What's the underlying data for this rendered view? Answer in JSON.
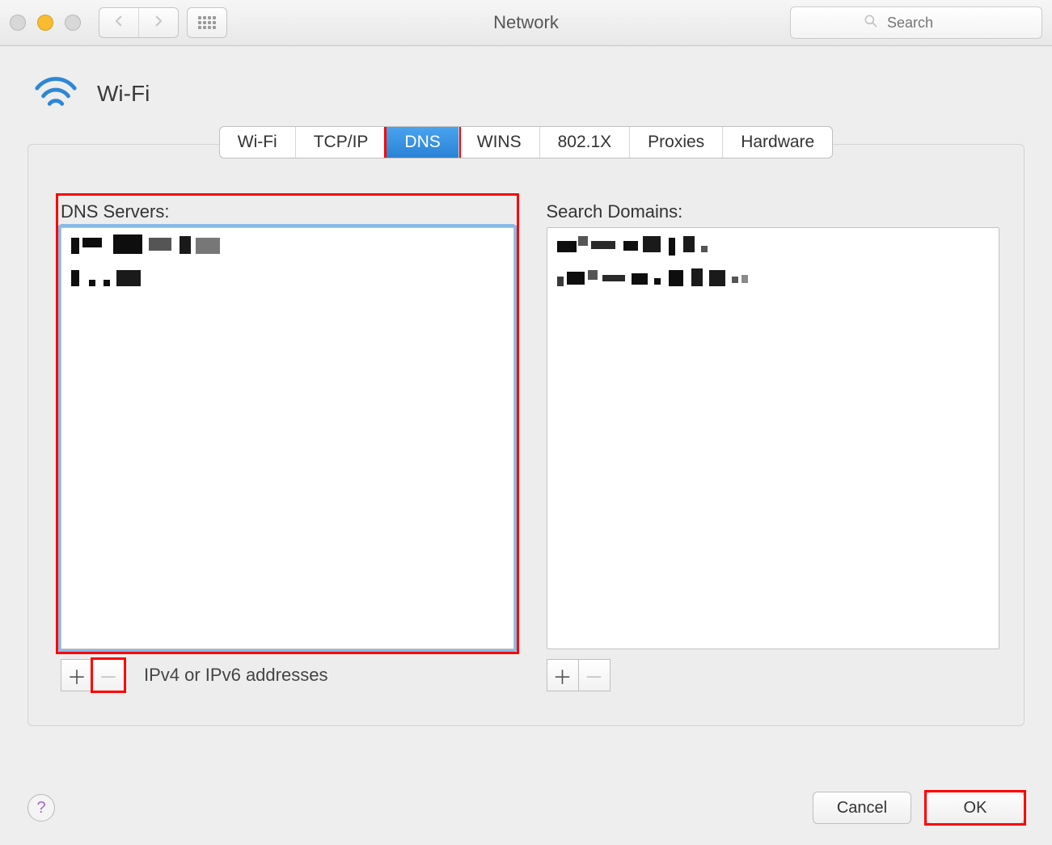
{
  "window": {
    "title": "Network"
  },
  "search": {
    "placeholder": "Search"
  },
  "connection": {
    "name": "Wi-Fi"
  },
  "tabs": [
    {
      "id": "wifi",
      "label": "Wi-Fi"
    },
    {
      "id": "tcpip",
      "label": "TCP/IP"
    },
    {
      "id": "dns",
      "label": "DNS",
      "active": true,
      "highlight": true
    },
    {
      "id": "wins",
      "label": "WINS"
    },
    {
      "id": "8021x",
      "label": "802.1X"
    },
    {
      "id": "proxies",
      "label": "Proxies"
    },
    {
      "id": "hardware",
      "label": "Hardware"
    }
  ],
  "dns": {
    "header": "DNS Servers:",
    "items": [
      "",
      ""
    ],
    "footer_label": "IPv4 or IPv6 addresses",
    "highlight": true
  },
  "domains": {
    "header": "Search Domains:",
    "items": [
      "",
      ""
    ]
  },
  "buttons": {
    "cancel": "Cancel",
    "ok": "OK"
  }
}
